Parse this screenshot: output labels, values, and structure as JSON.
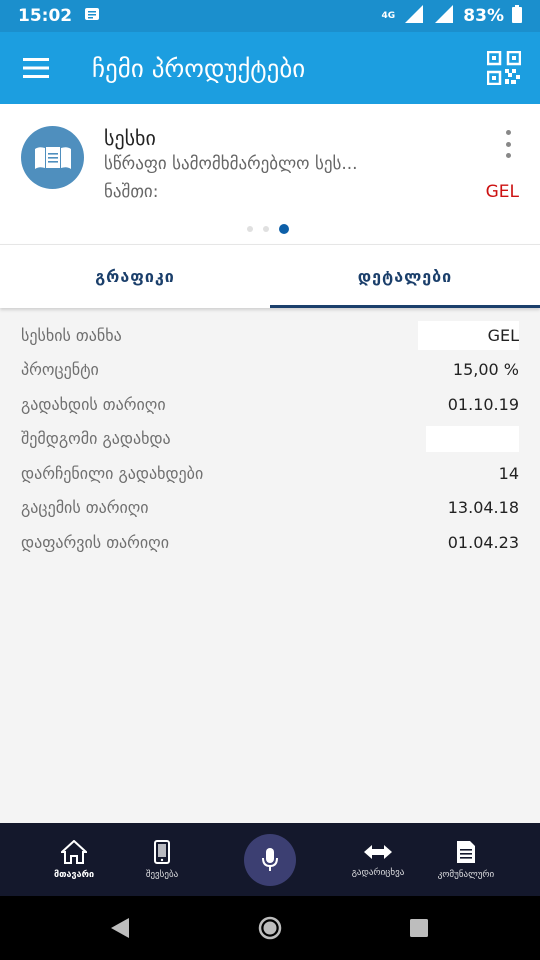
{
  "status_bar": {
    "time": "15:02",
    "network": "4G",
    "battery": "83%"
  },
  "header": {
    "title": "ჩემი პროდუქტები"
  },
  "product": {
    "name": "სესხი",
    "description": "სწრაფი სამომხმარებლო სეს...",
    "balance_label": "ნაშთი:",
    "currency": "GEL",
    "pager": {
      "total": 3,
      "active_index": 2
    }
  },
  "tabs": [
    {
      "label": "გრაფიკი",
      "active": false
    },
    {
      "label": "დეტალები",
      "active": true
    }
  ],
  "details": [
    {
      "label": "სესხის თანხა",
      "value": "GEL"
    },
    {
      "label": "პროცენტი",
      "value": "15,00 %"
    },
    {
      "label": "გადახდის თარიღი",
      "value": "01.10.19"
    },
    {
      "label": "შემდგომი გადახდა",
      "value": ""
    },
    {
      "label": "დარჩენილი გადახდები",
      "value": "14"
    },
    {
      "label": "გაცემის თარიღი",
      "value": "13.04.18"
    },
    {
      "label": "დაფარვის თარიღი",
      "value": "01.04.23"
    }
  ],
  "bottom_nav": {
    "items": [
      {
        "label": "მთავარი",
        "icon": "home-icon",
        "active": true
      },
      {
        "label": "შევსება",
        "icon": "phone-icon",
        "active": false
      },
      {
        "label": "გადარიცხვა",
        "icon": "transfer-icon",
        "active": false
      },
      {
        "label": "კომუნალური",
        "icon": "bill-icon",
        "active": false
      }
    ],
    "center": {
      "icon": "microphone-icon"
    }
  },
  "colors": {
    "status_bar": "#1b8fcd",
    "app_bar": "#1c9ee0",
    "accent": "#1b3f6b",
    "currency_red": "#cc1111",
    "bottom_nav_bg": "#14182c",
    "mic_bg": "#3c3f72"
  }
}
